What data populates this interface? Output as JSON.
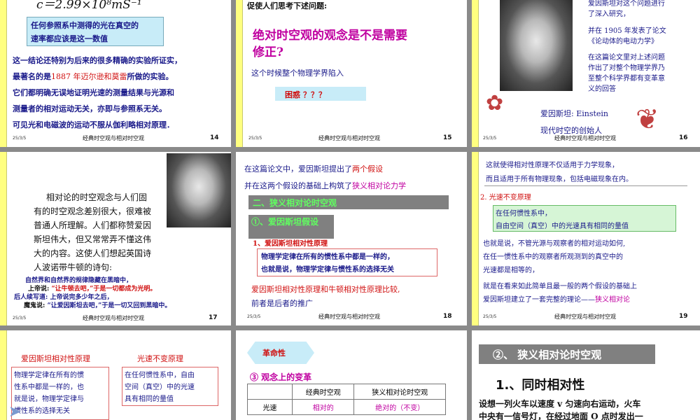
{
  "slide14": {
    "formula": "c＝2.99×10⁸mS⁻¹",
    "box": [
      "任何参照系中测得的光在真空的",
      "速率都应该是这一数值"
    ],
    "lines": [
      "这一结论还特别为后来的很多精确的实验所证实，",
      "最著名的是",
      "1887 年迈尔逊和莫雷",
      "所做的实验。",
      "它们都明确无误地证明光速的测量结果与光源和",
      "测量者的相对运动无关，亦即与参照系无关。",
      "可见光和电磁波的运动不服从伽利略相对原理．"
    ],
    "date": "25/3/5",
    "footer": "经典时空观与相对时空观",
    "page": "14"
  },
  "slide15": {
    "intro": "促使人们思考下述问题:",
    "question": [
      "绝对时空观的观念是不是需要",
      "修正?"
    ],
    "line": "这个时候整个物理学界陷入",
    "box": "困惑 ？？？",
    "date": "25/3/5",
    "footer": "经典时空观与相对时空观",
    "page": "15"
  },
  "slide16": {
    "lines": [
      "爱因斯坦对这个问题进行",
      "了深入研究，",
      "并在 1905 年发表了论文",
      "《论动体的电动力学》",
      "在这篇论文里对上述问题",
      "作出了对整个物理学界乃",
      "至整个科学界都有变革意",
      "义的回答"
    ],
    "caption1": "爱因斯坦: Einstein",
    "caption2": "现代时空的创始人",
    "date": "25/3/5",
    "footer": "经典时空观与相对时空观",
    "page": "16"
  },
  "slide17": {
    "lines": [
      "相对论的时空观念与人们固",
      "有的时空观念差别很大，很难被",
      "普通人所理解。人们都称赞爱因",
      "斯坦伟大，但又常常弄不懂这伟",
      "大的内容。这使人们想起英国诗",
      "人波诺带牛顿的诗句:"
    ],
    "poem1": "自然界和自然界的规律隐藏在黑暗中，",
    "poem2a": "上帝说:",
    "poem2b": "“让牛顿去吧，”于是一切都成为光明。",
    "poem3a": "后人续写道:",
    "poem3b": "上帝说完多少年之后，",
    "poem4a": "魔鬼说:",
    "poem4b": "“让爱因斯坦去吧，”于是一切又回到黑暗中。",
    "date": "25/3/5",
    "footer": "经典时空观与相对时空观",
    "page": "17"
  },
  "slide18": {
    "line1a": "在这篇论文中，爱因斯坦提出了",
    "line1b": "两个假设",
    "line2a": "并在这两个假设的基础上构筑了",
    "line2b": "狭义相对论力学",
    "header": "二、狭义相对论时空观",
    "sub": "①、爱因斯坦假设",
    "subline": "1、爱因斯坦相对性原理",
    "box": [
      "物理学定律在所有的惯性系中都是一样的，",
      "也就是说，物理学定律与惯性系的选择无关"
    ],
    "compare": "爱因斯坦相对性原理和牛顿相对性原理比较,",
    "compare2": "前者是后者的推广",
    "date": "25/3/5",
    "footer": "经典时空观与相对时空观",
    "page": "18"
  },
  "slide19": {
    "line1": "这就使得相对性原理不仅适用于力学现象，",
    "line2": "而且适用于所有物理现象，包括电磁现象在内。",
    "item": "2.  光速不变原理",
    "box": [
      "在任何惯性系中，",
      "自由空间（真空）中的光速具有相同的量值"
    ],
    "body": [
      "也就是说，不管光源与观察者的相对运动如何,",
      "在任一惯性系中的观察者所观测到的真空中的",
      "光速都是相等的，"
    ],
    "last1": "就是在看来如此简单且最一般的两个假设的基础上",
    "last2a": "爱因斯坦建立了一套完整的理论——",
    "last2b": "狭义相对论",
    "date": "25/3/5",
    "footer": "经典时空观与相对时空观",
    "page": "19"
  },
  "slide20": {
    "title1": "爱因斯坦相对性原理",
    "title2": "光速不变原理",
    "box1": [
      "物理学定律在所有的惯",
      "性系中都是一样的，也",
      "就是说，物理学定律与",
      "惯性系的选择无关"
    ],
    "box2": [
      "在任何惯性系中，自由",
      "空间（真空）中的光速",
      "具有相同的量值"
    ]
  },
  "slide21": {
    "tag": "革命性",
    "heading": "③  观念上的变革",
    "table": {
      "headers": [
        "",
        "经典时空观",
        "狭义相对论时空观"
      ],
      "rows": [
        [
          "光速",
          "相对的",
          "绝对的（不变）"
        ]
      ]
    }
  },
  "slide22": {
    "header": "②、  狭义相对论时空观",
    "title": "1.、同时相对性",
    "lines": [
      "设想一列火车以速度 v 匀速向右运动，火车",
      "中央有一信号灯，在经过地面 O 点时发出一"
    ]
  },
  "colors": {
    "bar": "#ffff80",
    "blue": "#1a1a8a",
    "red": "#d01010",
    "magenta": "#c000a0"
  }
}
